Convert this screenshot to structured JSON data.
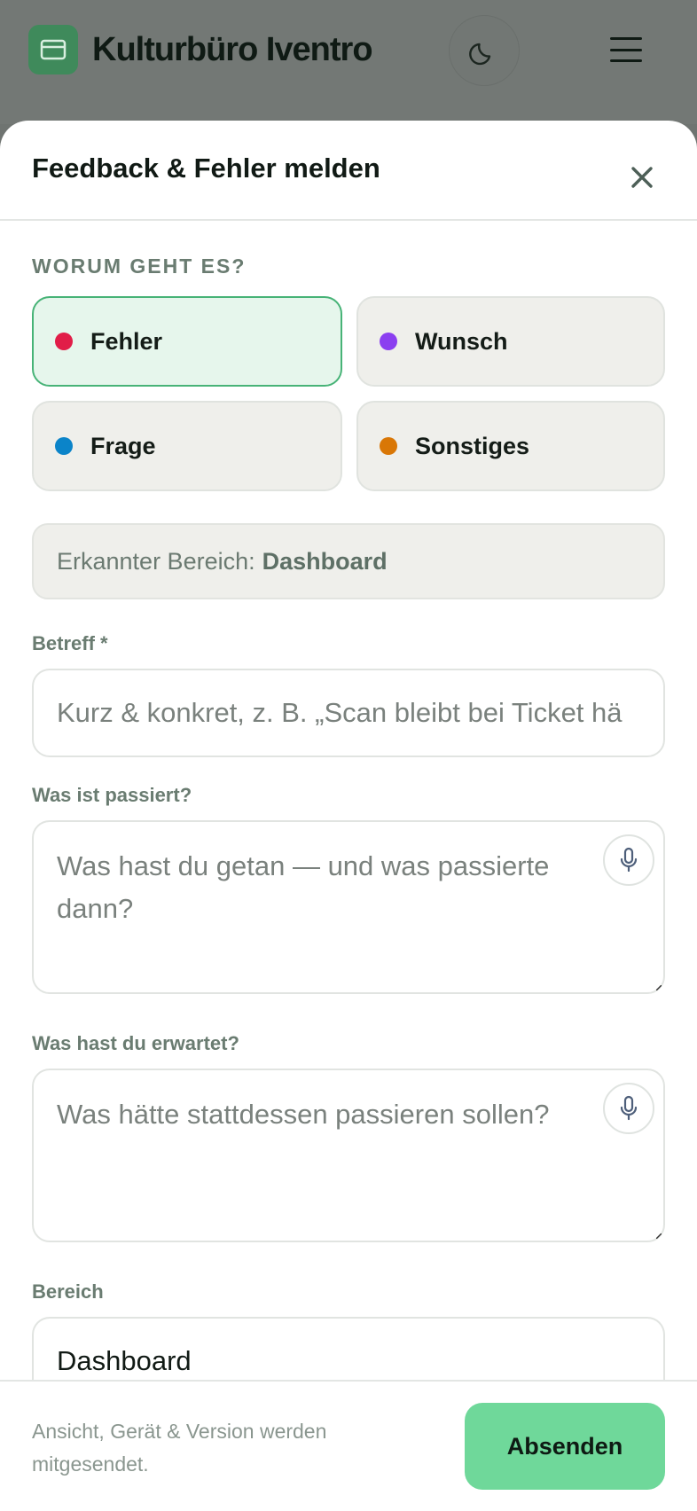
{
  "app": {
    "title": "Kulturbüro Iventro"
  },
  "dialog": {
    "title": "Feedback & Fehler melden",
    "section_label": "WORUM GEHT ES?",
    "types": [
      {
        "label": "Fehler",
        "color": "#e11d48",
        "selected": true
      },
      {
        "label": "Wunsch",
        "color": "#8b3ff0",
        "selected": false
      },
      {
        "label": "Frage",
        "color": "#0b84c9",
        "selected": false
      },
      {
        "label": "Sonstiges",
        "color": "#d97706",
        "selected": false
      }
    ],
    "detected_prefix": "Erkannter Bereich:",
    "detected_value": "Dashboard",
    "subject": {
      "label": "Betreff *",
      "placeholder": "Kurz & konkret, z. B. „Scan bleibt bei Ticket hä",
      "value": ""
    },
    "what_happened": {
      "label": "Was ist passiert?",
      "placeholder": "Was hast du getan — und was passierte dann?",
      "value": ""
    },
    "expected": {
      "label": "Was hast du erwartet?",
      "placeholder": "Was hätte stattdessen passieren sollen?",
      "value": ""
    },
    "area": {
      "label": "Bereich",
      "value": "Dashboard"
    },
    "footer_note": "Ansicht, Gerät & Version werden mitgesendet.",
    "submit_label": "Absenden"
  },
  "colors": {
    "accent": "#6fd89a",
    "selected_border": "#47b377",
    "logo": "#3f8a5b"
  },
  "icons": {
    "logo": "card-icon",
    "theme": "moon-icon",
    "menu": "hamburger-icon",
    "close": "close-icon",
    "mic": "microphone-icon"
  }
}
